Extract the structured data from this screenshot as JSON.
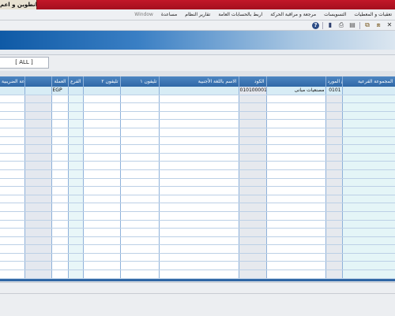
{
  "window": {
    "title": "انطوين و اعم"
  },
  "menu": {
    "items": [
      {
        "label": "Window",
        "muted": true
      },
      {
        "label": "مساعدة"
      },
      {
        "label": "تقارير النظام"
      },
      {
        "label": "اربط بالحسابات العامة"
      },
      {
        "label": "مرجعة و مراقبة الحركة"
      },
      {
        "label": "التسويسات"
      },
      {
        "label": "تعقبات و المعطيات"
      }
    ]
  },
  "toolbar": {
    "tools": [
      {
        "name": "help-icon",
        "glyph": "?"
      },
      {
        "name": "exit-icon",
        "glyph": "▮"
      },
      {
        "name": "print-icon",
        "glyph": "⎙"
      },
      {
        "name": "preview-icon",
        "glyph": "▤"
      },
      {
        "name": "copy-icon",
        "glyph": "⧉"
      },
      {
        "name": "paste-icon",
        "glyph": "⧈"
      },
      {
        "name": "close-icon",
        "glyph": "✕"
      }
    ]
  },
  "filter": {
    "tab_label": "[ ALL ]"
  },
  "grid": {
    "columns": [
      {
        "key": "tax",
        "label": "المجموعة الضريبية"
      },
      {
        "key": "currency",
        "label": "العملة"
      },
      {
        "key": "branch",
        "label": "الفرع"
      },
      {
        "key": "phone2",
        "label": "تليفون ٢"
      },
      {
        "key": "phone1",
        "label": "تليفون ١"
      },
      {
        "key": "foreign_name",
        "label": "الاسم باللغة الأجنبية"
      },
      {
        "key": "code",
        "label": "الكود"
      },
      {
        "key": "name",
        "label": ""
      },
      {
        "key": "type",
        "label": "نوع المورد"
      },
      {
        "key": "group",
        "label": "المجموعة الفرعية"
      }
    ],
    "rows": [
      {
        "tax": "",
        "currency": "EGP",
        "branch": "",
        "phone2": "",
        "phone1": "",
        "foreign_name": "",
        "code": "010100001",
        "name": "مصنعيات مبانى",
        "type": "0101",
        "group": ""
      }
    ],
    "empty_row_count": 24
  }
}
